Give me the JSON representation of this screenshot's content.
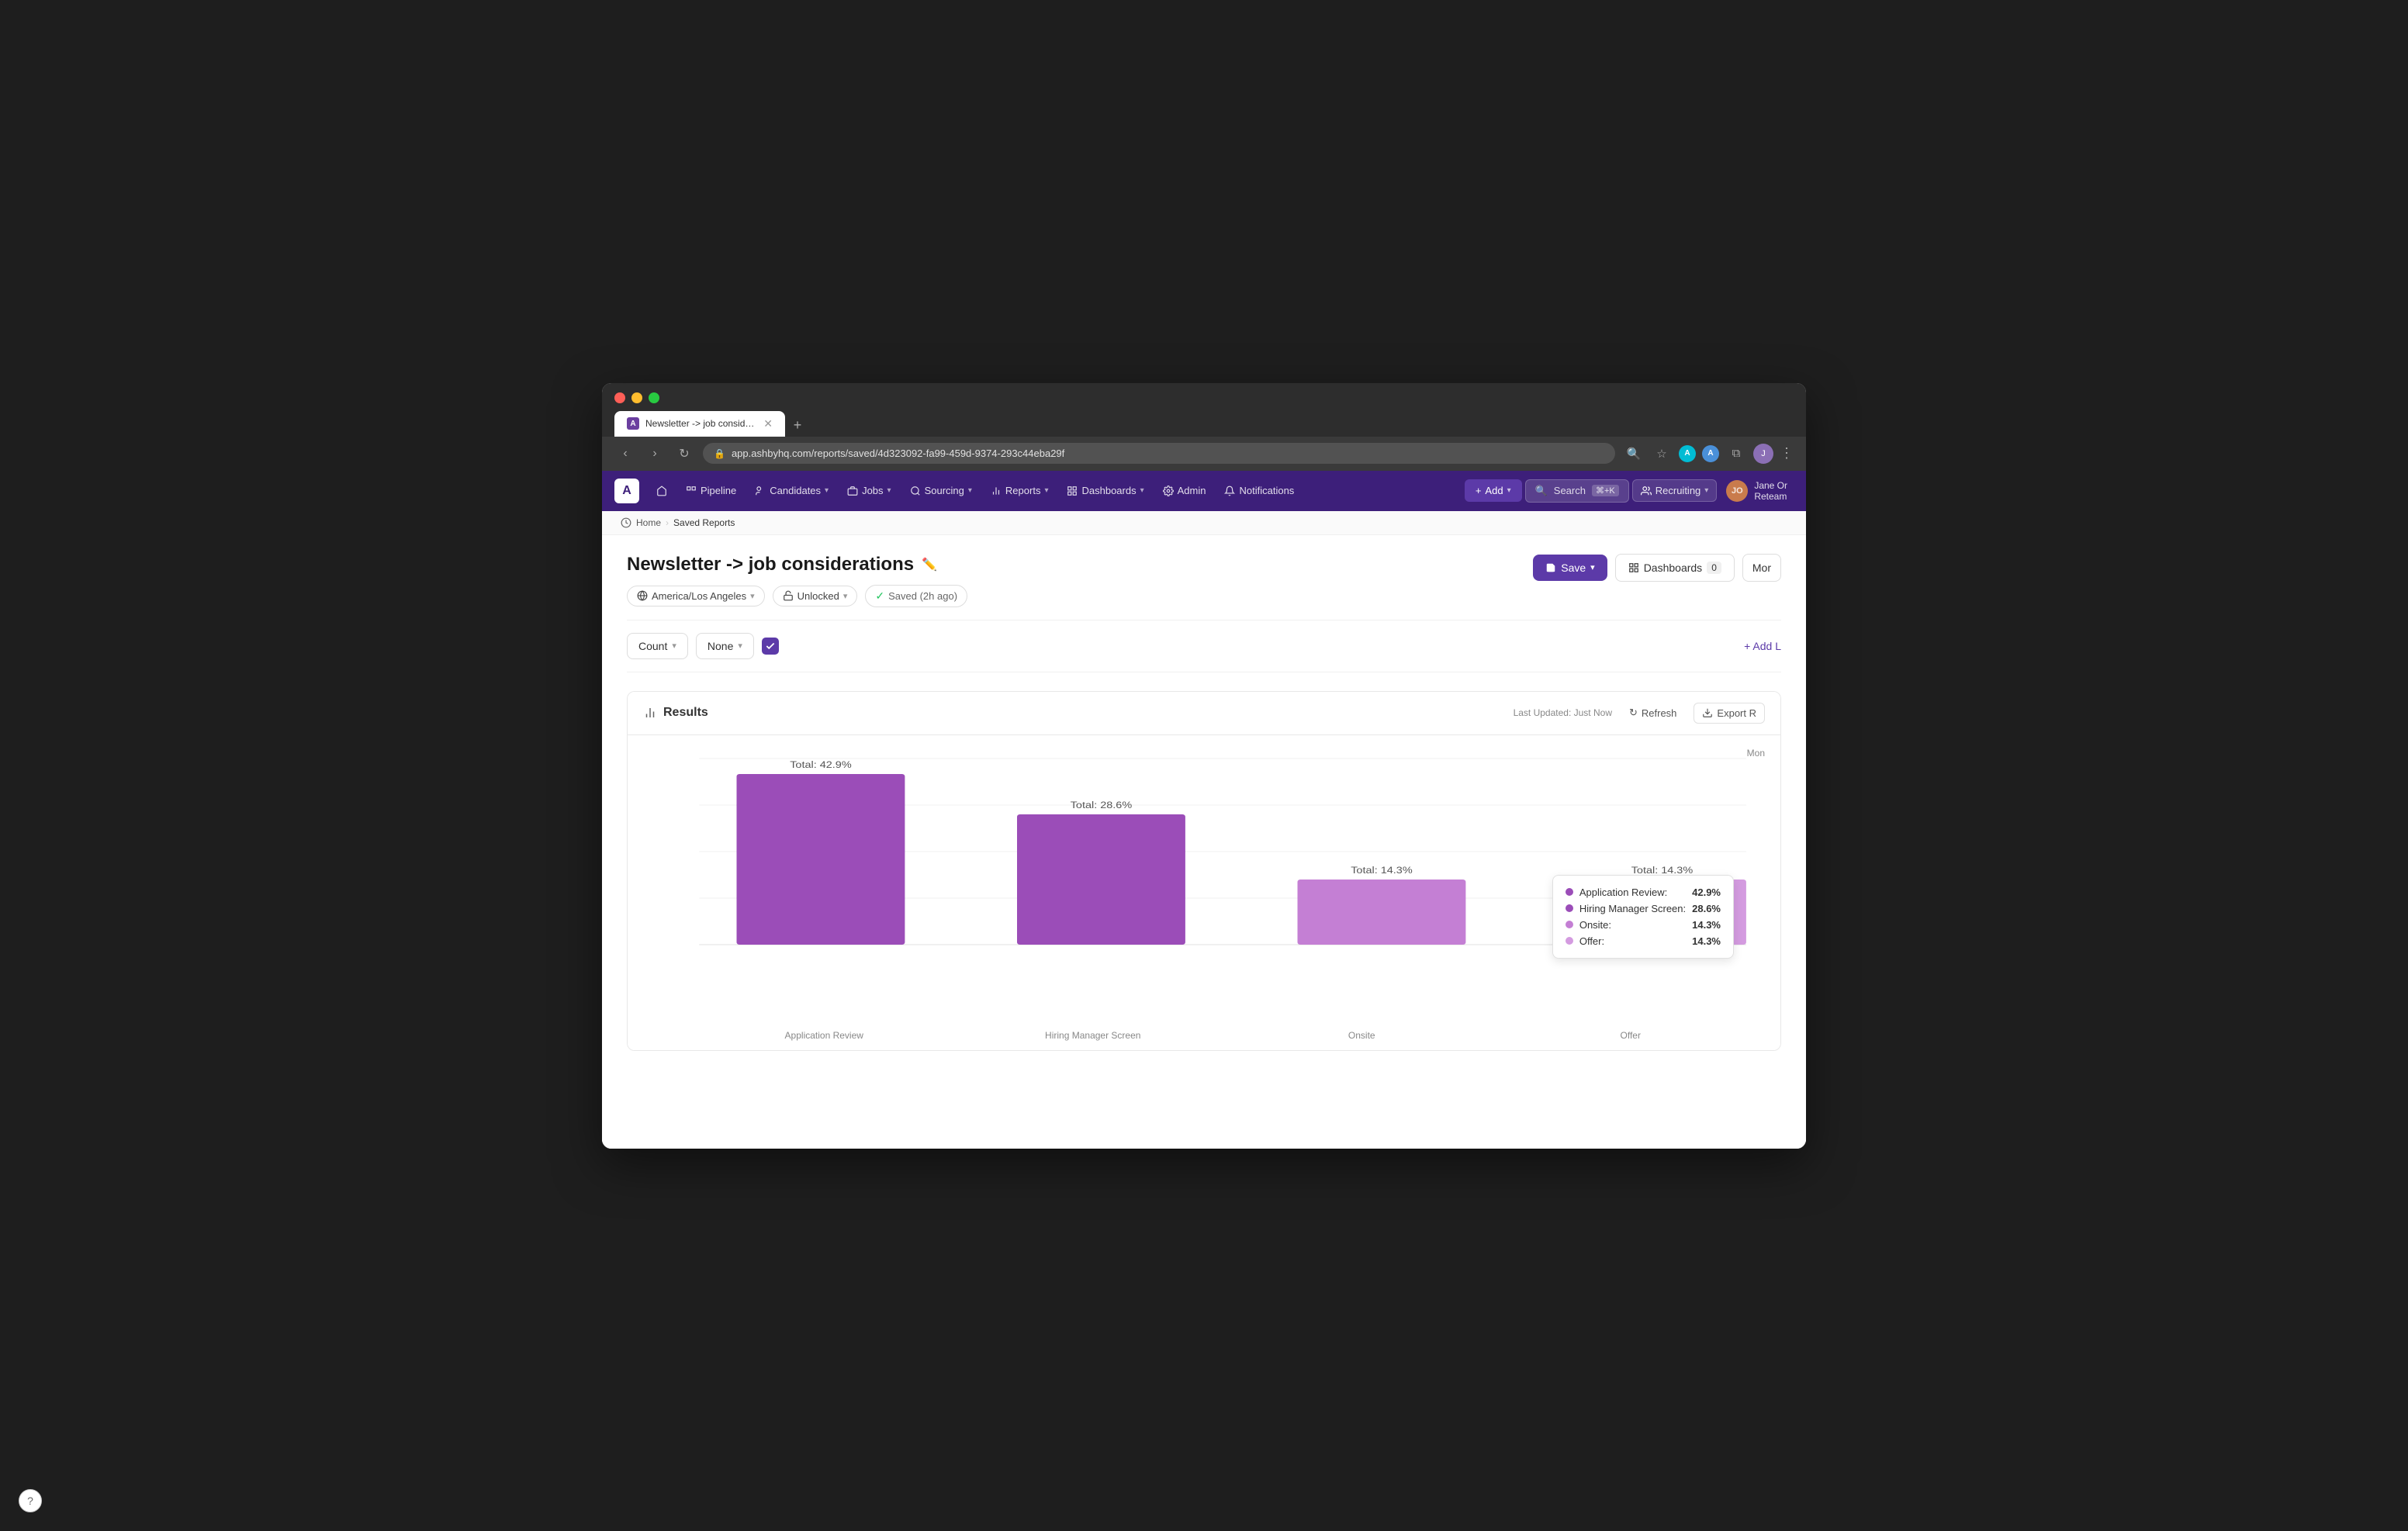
{
  "browser": {
    "tab_title": "Newsletter -> job considerati",
    "url": "app.ashbyhq.com/reports/saved/4d323092-fa99-459d-9374-293c44eba29f",
    "new_tab_label": "+"
  },
  "nav": {
    "logo": "A",
    "home_icon": "house",
    "pipeline_label": "Pipeline",
    "candidates_label": "Candidates",
    "jobs_label": "Jobs",
    "sourcing_label": "Sourcing",
    "reports_label": "Reports",
    "dashboards_label": "Dashboards",
    "admin_label": "Admin",
    "notifications_label": "Notifications",
    "add_label": "Add",
    "search_label": "Search",
    "search_shortcut": "⌘+K",
    "recruiting_label": "Recruiting",
    "user_initials": "JO",
    "user_name": "Jane Or",
    "user_team": "Reteam"
  },
  "breadcrumb": {
    "home": "Home",
    "saved_reports": "Saved Reports"
  },
  "report": {
    "title": "Newsletter -> job considerations",
    "timezone_label": "America/Los Angeles",
    "lock_label": "Unlocked",
    "saved_label": "Saved (2h ago)",
    "save_btn": "Save",
    "dashboards_btn": "Dashboards",
    "dashboards_count": "0",
    "more_btn": "Mor"
  },
  "filters": {
    "count_label": "Count",
    "none_label": "None",
    "add_line_label": "+ Add L"
  },
  "results": {
    "title": "Results",
    "last_updated": "Last Updated: Just Now",
    "refresh_label": "Refresh",
    "export_label": "Export R"
  },
  "chart": {
    "bars": [
      {
        "label": "Application Review",
        "total": "Total: 42.9%",
        "value": 42.9,
        "color": "#9b4db8"
      },
      {
        "label": "Hiring Manager Screen",
        "total": "Total: 28.6%",
        "value": 28.6,
        "color": "#9b4db8"
      },
      {
        "label": "Onsite",
        "total": "Total: 14.3%",
        "value": 14.3,
        "color": "#c47fd4"
      },
      {
        "label": "Offer",
        "total": "Total: 14.3%",
        "value": 14.3,
        "color": "#d49be0"
      }
    ],
    "tooltip": {
      "items": [
        {
          "label": "Application Review:",
          "value": "42.9%",
          "color": "#9b4db8"
        },
        {
          "label": "Hiring Manager Screen:",
          "value": "28.6%",
          "color": "#9b4db8"
        },
        {
          "label": "Onsite:",
          "value": "14.3%",
          "color": "#c47fd4"
        },
        {
          "label": "Offer:",
          "value": "14.3%",
          "color": "#d49be0"
        }
      ]
    },
    "mon_label": "Mon"
  },
  "help": {
    "icon": "?"
  }
}
